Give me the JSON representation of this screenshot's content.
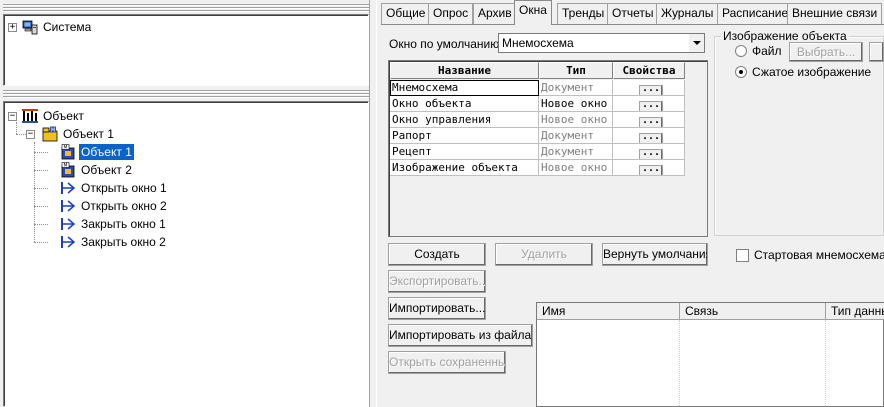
{
  "tree_top": {
    "items": [
      {
        "label": "Система"
      }
    ]
  },
  "tree_bottom": {
    "items": [
      {
        "label": "Объект"
      },
      {
        "label": "Объект 1"
      },
      {
        "label": "Объект 1"
      },
      {
        "label": "Объект 2"
      },
      {
        "label": "Открыть окно 1"
      },
      {
        "label": "Открыть окно 2"
      },
      {
        "label": "Закрыть окно 1"
      },
      {
        "label": "Закрыть окно 2"
      }
    ]
  },
  "tabs": [
    "Общие",
    "Опрос",
    "Архив",
    "Окна",
    "Тренды",
    "Отчеты",
    "Журналы",
    "Расписание",
    "Внешние связи"
  ],
  "active_tab": "Окна",
  "default_window": {
    "label": "Окно по умолчанию :",
    "value": "Мнемосхема"
  },
  "windows_table": {
    "headers": [
      "Название",
      "Тип",
      "Свойства"
    ],
    "rows": [
      {
        "name": "Мнемосхема",
        "type": "Документ",
        "props": "..."
      },
      {
        "name": "Окно объекта",
        "type": "Новое окно",
        "props": "..."
      },
      {
        "name": "Окно управления",
        "type": "Новое окно",
        "props": "..."
      },
      {
        "name": "Рапорт",
        "type": "Документ",
        "props": "..."
      },
      {
        "name": "Рецепт",
        "type": "Документ",
        "props": "..."
      },
      {
        "name": "Изображение объекта",
        "type": "Новое окно",
        "props": "..."
      }
    ]
  },
  "object_image": {
    "caption": "Изображение объекта",
    "file_label": "Файл",
    "choose_label": "Выбрать...",
    "compressed_label": "Сжатое изображение"
  },
  "buttons": {
    "create": "Создать",
    "delete": "Удалить",
    "restore_defaults": "Вернуть умолчания",
    "export": "Экспортировать...",
    "import": "Импортировать...",
    "import_file": "Импортировать из файла...",
    "open_saved": "Открыть сохраненные"
  },
  "start_mnemo_label": "Стартовая мнемосхема к",
  "bindings_table": {
    "headers": [
      "Имя",
      "Связь",
      "Тип данны"
    ]
  }
}
